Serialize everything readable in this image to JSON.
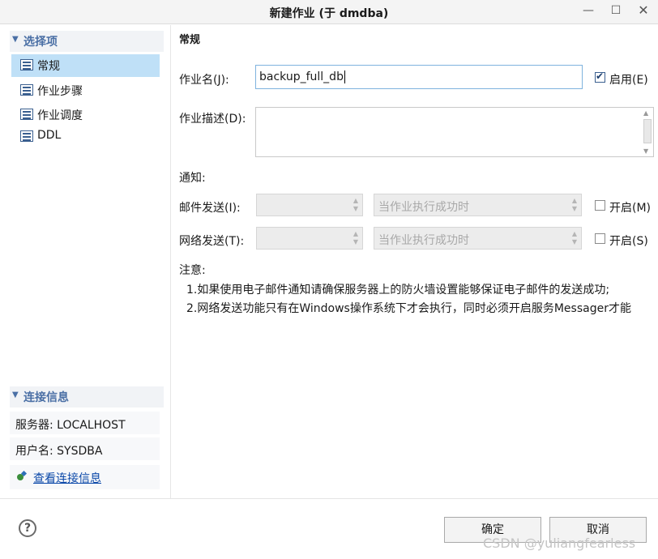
{
  "window": {
    "title": "新建作业  (于 dmdba)"
  },
  "sidebar": {
    "select_section": "选择项",
    "items": [
      {
        "label": "常规",
        "selected": true
      },
      {
        "label": "作业步骤",
        "selected": false
      },
      {
        "label": "作业调度",
        "selected": false
      },
      {
        "label": "DDL",
        "selected": false
      }
    ],
    "connection_section": "连接信息",
    "server": "服务器: LOCALHOST",
    "user": "用户名: SYSDBA",
    "view_link": "查看连接信息"
  },
  "main": {
    "heading": "常规",
    "job_name_label": "作业名(J):",
    "job_name_value": "backup_full_db",
    "enable_label": "启用(E)",
    "enable_checked": true,
    "desc_label": "作业描述(D):",
    "desc_value": "",
    "notify_label": "通知:",
    "mail_label": "邮件发送(I):",
    "mail_condition": "当作业执行成功时",
    "mail_open_label": "开启(M)",
    "net_label": "网络发送(T):",
    "net_condition": "当作业执行成功时",
    "net_open_label": "开启(S)",
    "note_title": "注意:",
    "note_1": "1.如果使用电子邮件通知请确保服务器上的防火墙设置能够保证电子邮件的发送成功;",
    "note_2": "2.网络发送功能只有在Windows操作系统下才会执行，同时必须开启服务Messager才能"
  },
  "footer": {
    "help": "?",
    "ok": "确定",
    "cancel": "取消",
    "watermark": "CSDN @yuliangfearless"
  }
}
